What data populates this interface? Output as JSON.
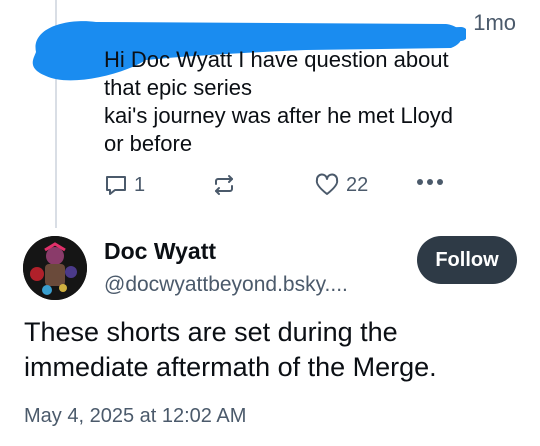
{
  "reply": {
    "time": "1mo",
    "text": "Hi Doc Wyatt I have question about\nthat epic series\nkai's journey was after he met Lloyd\nor before",
    "reply_count": "1",
    "like_count": "22"
  },
  "post": {
    "display_name": "Doc Wyatt",
    "handle": "@docwyattbeyond.bsky....",
    "follow_label": "Follow",
    "text": "These shorts are set during the immediate aftermath of the Merge.",
    "date": "May 4, 2025 at 12:02 AM"
  },
  "colors": {
    "redaction": "#1a8cf0",
    "muted": "#4b5a6b",
    "follow_bg": "#2e3a46"
  },
  "icons": {
    "reply": "speech-bubble-icon",
    "repost": "repost-arrows-icon",
    "like": "heart-icon",
    "more": "more-dots-icon"
  }
}
